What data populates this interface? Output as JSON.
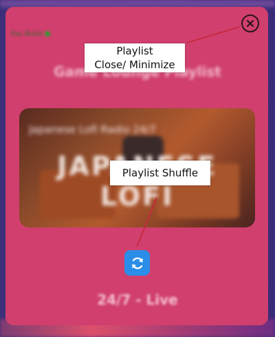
{
  "app": {
    "tag_label": "Fav Build",
    "playlist_title": "Game Lounge Playlist",
    "video": {
      "title": "Japanese Lofi Radio 24/7",
      "overlay_text": "JAPANESE LOFI"
    },
    "status_text": "24/7 - Live"
  },
  "controls": {
    "close_icon": "close-circle-icon",
    "shuffle_icon": "refresh-icon"
  },
  "annotations": {
    "close_callout_line1": "Playlist",
    "close_callout_line2": "Close/ Minimize",
    "shuffle_callout": "Playlist  Shuffle"
  },
  "colors": {
    "card": "#d03f6d",
    "shuffle_button": "#2a8ee8",
    "arrow": "#c8283f"
  }
}
